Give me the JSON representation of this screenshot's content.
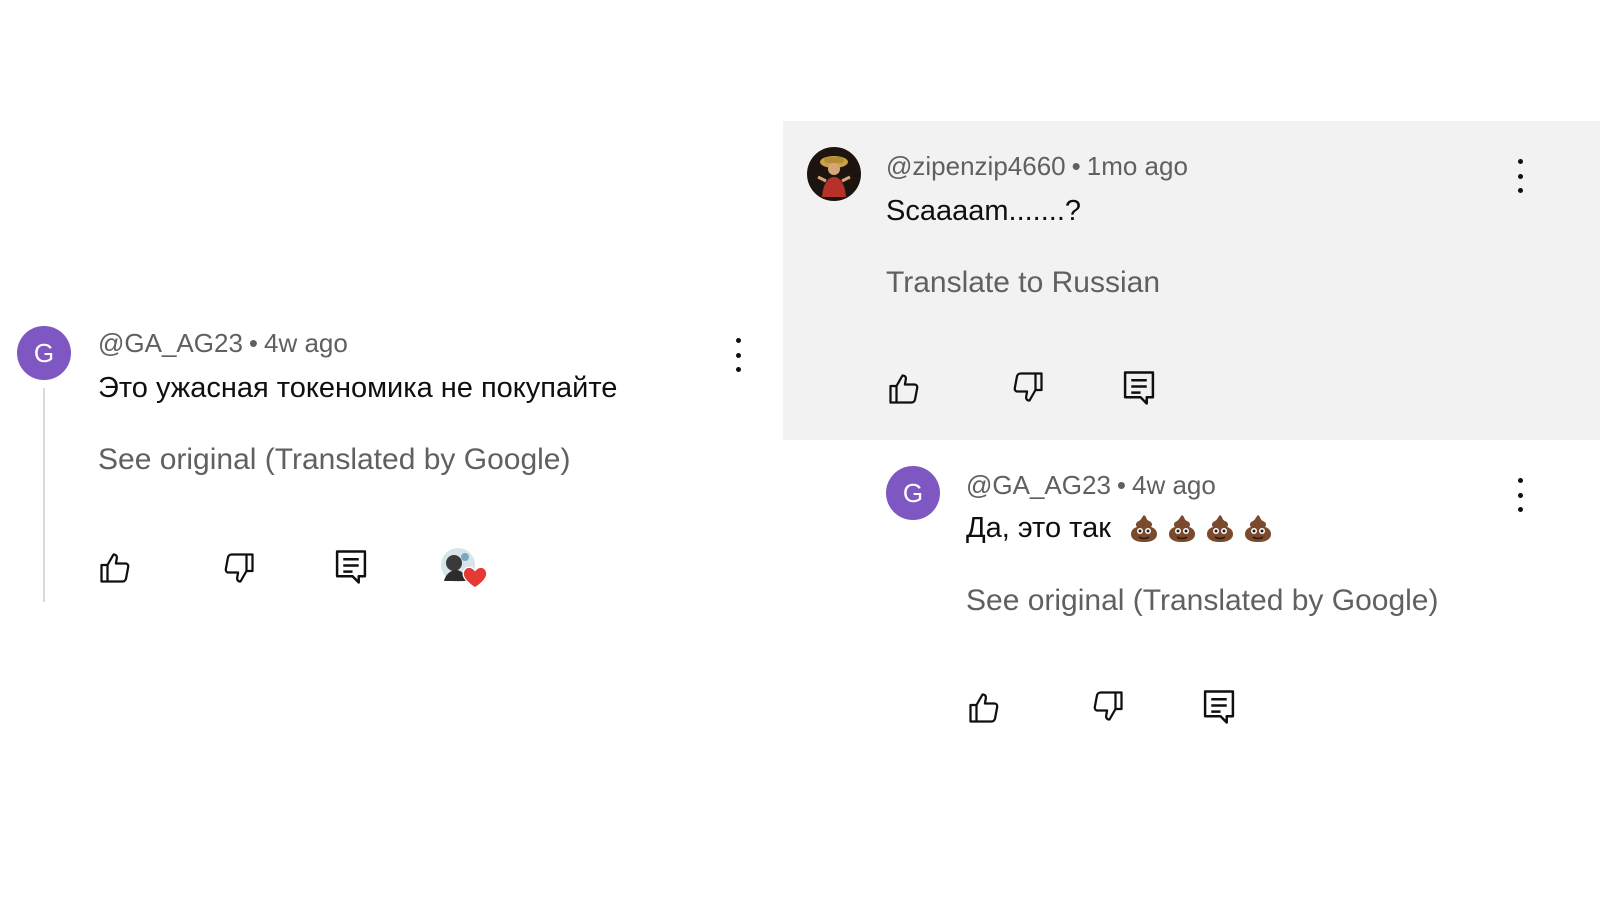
{
  "left_comment": {
    "avatar_letter": "G",
    "author": "@GA_AG23",
    "separator": "•",
    "time": "4w ago",
    "text": "Это ужасная токеномика не покупайте",
    "translate_link": "See original (Translated by Google)",
    "hearted_by_creator": true
  },
  "parent_comment": {
    "author": "@zipenzip4660",
    "separator": "•",
    "time": "1mo ago",
    "text": "Scaaaam.......?",
    "translate_link": "Translate to Russian"
  },
  "reply_comment": {
    "avatar_letter": "G",
    "author": "@GA_AG23",
    "separator": "•",
    "time": "4w ago",
    "text": "Да, это так",
    "emoji_count": 4,
    "emoji": "pile-of-poo",
    "translate_link": "See original (Translated by Google)"
  },
  "colors": {
    "avatar_purple": "#7e57c2",
    "highlight_bg": "#f2f2f2",
    "meta_gray": "#606060",
    "heart_red": "#e53935"
  }
}
